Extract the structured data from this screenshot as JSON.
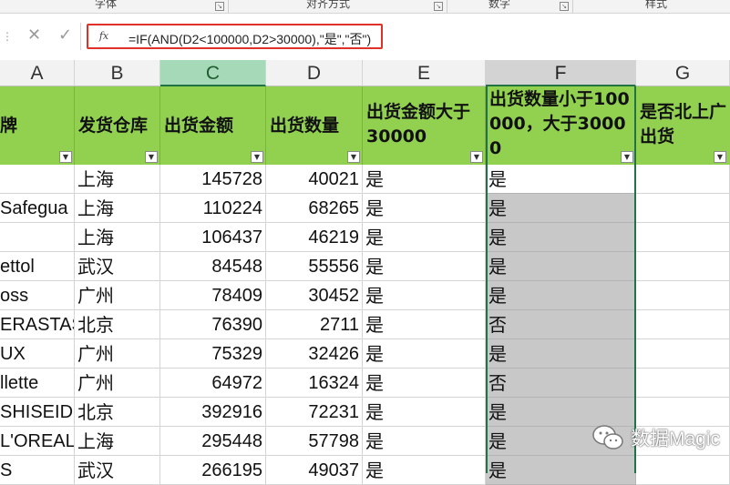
{
  "ribbon": {
    "groups": [
      "字体",
      "对齐方式",
      "数字",
      "样式"
    ]
  },
  "formula_bar": {
    "cancel_icon": "close-icon",
    "confirm_icon": "check-icon",
    "fx_label": "fx",
    "formula": "=IF(AND(D2<100000,D2>30000),\"是\",\"否\")"
  },
  "columns": [
    "A",
    "B",
    "C",
    "D",
    "E",
    "F",
    "G"
  ],
  "header_row": {
    "a": "牌",
    "b": "发货仓库",
    "c": "出货金额",
    "d": "出货数量",
    "e": "出货金额大于30000",
    "f": "出货数量小于100000，大于30000",
    "g": "是否北上广出货"
  },
  "rows": [
    {
      "a": "",
      "b": "上海",
      "c": "145728",
      "d": "40021",
      "e": "是",
      "f": "是"
    },
    {
      "a": "Safegua",
      "b": "上海",
      "c": "110224",
      "d": "68265",
      "e": "是",
      "f": "是"
    },
    {
      "a": "",
      "b": "上海",
      "c": "106437",
      "d": "46219",
      "e": "是",
      "f": "是"
    },
    {
      "a": "ettol",
      "b": "武汉",
      "c": "84548",
      "d": "55556",
      "e": "是",
      "f": "是"
    },
    {
      "a": "oss",
      "b": "广州",
      "c": "78409",
      "d": "30452",
      "e": "是",
      "f": "是"
    },
    {
      "a": "ERASTAS",
      "b": "北京",
      "c": "76390",
      "d": "2711",
      "e": "是",
      "f": "否"
    },
    {
      "a": "UX",
      "b": "广州",
      "c": "75329",
      "d": "32426",
      "e": "是",
      "f": "是"
    },
    {
      "a": "llette",
      "b": "广州",
      "c": "64972",
      "d": "16324",
      "e": "是",
      "f": "否"
    },
    {
      "a": "SHISEID",
      "b": "北京",
      "c": "392916",
      "d": "72231",
      "e": "是",
      "f": "是"
    },
    {
      "a": "L'OREAL",
      "b": "上海",
      "c": "295448",
      "d": "57798",
      "e": "是",
      "f": "是"
    },
    {
      "a": "S",
      "b": "武汉",
      "c": "266195",
      "d": "49037",
      "e": "是",
      "f": "是"
    }
  ],
  "watermark": "数据Magic",
  "colors": {
    "header_fill": "#92d050",
    "selection": "#217346",
    "formula_highlight": "#e0302a"
  }
}
